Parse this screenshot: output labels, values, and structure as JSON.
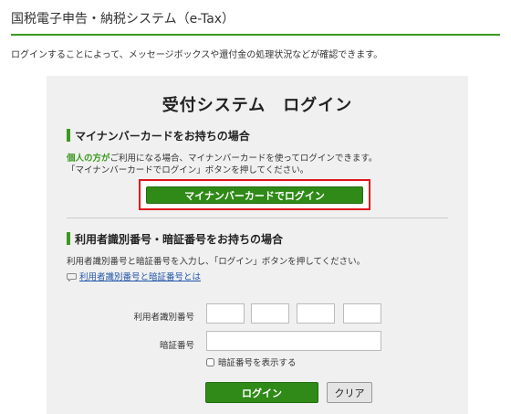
{
  "header": {
    "site_title": "国税電子申告・納税システム（e-Tax）"
  },
  "intro": "ログインすることによって、メッセージボックスや還付金の処理状況などが確認できます。",
  "panel": {
    "title": "受付システム　ログイン",
    "mynumber_section": {
      "heading": "マイナンバーカードをお持ちの場合",
      "desc_highlight": "個人の方が",
      "desc_line1_rest": "ご利用になる場合、マイナンバーカードを使ってログインできます。",
      "desc_line2": "「マイナンバーカードでログイン」ボタンを押してください。",
      "button_label": "マイナンバーカードでログイン"
    },
    "id_section": {
      "heading": "利用者識別番号・暗証番号をお持ちの場合",
      "desc": "利用者識別番号と暗証番号を入力し、「ログイン」ボタンを押してください。",
      "help_link": "利用者識別番号と暗証番号とは",
      "id_label": "利用者識別番号",
      "pw_label": "暗証番号",
      "show_pw_label": "暗証番号を表示する",
      "show_pw_checked": false,
      "login_label": "ログイン",
      "clear_label": "クリア"
    }
  },
  "colors": {
    "accent_green": "#3a9a1e",
    "button_green": "#2f8a17",
    "highlight_frame": "#e0141e",
    "link": "#2255aa"
  },
  "icons": {
    "help": "speech-bubble-icon"
  }
}
